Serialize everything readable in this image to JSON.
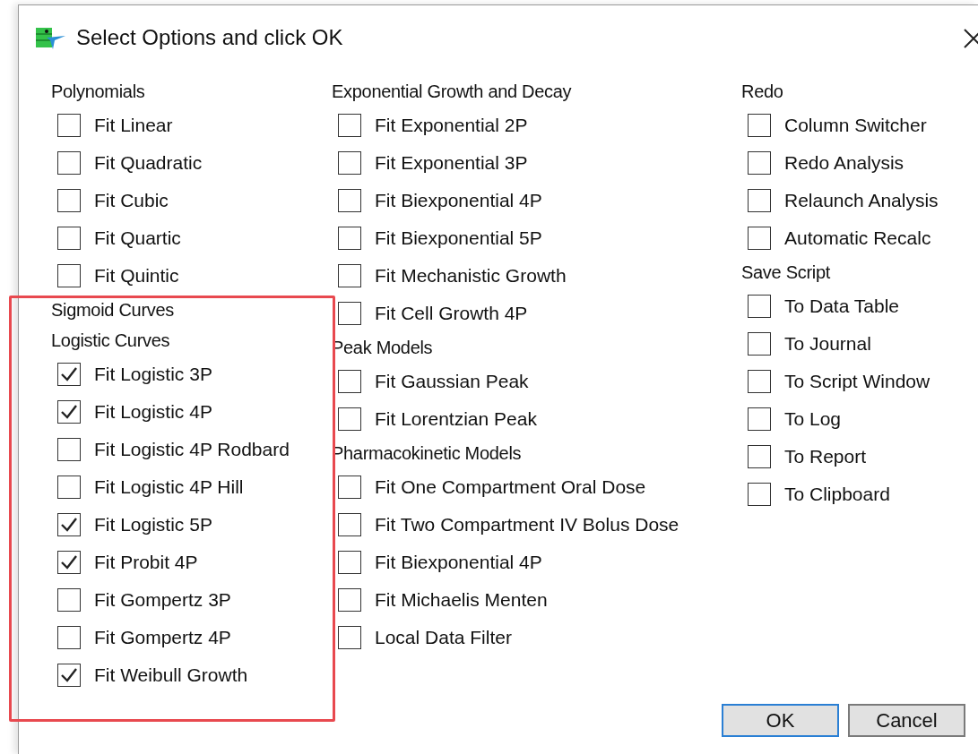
{
  "window": {
    "title": "Select Options and click OK"
  },
  "columns": [
    {
      "items": [
        {
          "kind": "heading",
          "label": "Polynomials"
        },
        {
          "kind": "checkbox",
          "label": "Fit Linear",
          "checked": false
        },
        {
          "kind": "checkbox",
          "label": "Fit Quadratic",
          "checked": false
        },
        {
          "kind": "checkbox",
          "label": "Fit Cubic",
          "checked": false
        },
        {
          "kind": "checkbox",
          "label": "Fit Quartic",
          "checked": false
        },
        {
          "kind": "checkbox",
          "label": "Fit Quintic",
          "checked": false
        },
        {
          "kind": "heading",
          "label": "Sigmoid Curves"
        },
        {
          "kind": "heading",
          "label": "Logistic Curves"
        },
        {
          "kind": "checkbox",
          "label": "Fit Logistic 3P",
          "checked": true
        },
        {
          "kind": "checkbox",
          "label": "Fit Logistic 4P",
          "checked": true
        },
        {
          "kind": "checkbox",
          "label": "Fit Logistic 4P Rodbard",
          "checked": false
        },
        {
          "kind": "checkbox",
          "label": "Fit Logistic 4P Hill",
          "checked": false
        },
        {
          "kind": "checkbox",
          "label": "Fit Logistic 5P",
          "checked": true
        },
        {
          "kind": "checkbox",
          "label": "Fit Probit 4P",
          "checked": true
        },
        {
          "kind": "checkbox",
          "label": "Fit Gompertz 3P",
          "checked": false
        },
        {
          "kind": "checkbox",
          "label": "Fit Gompertz 4P",
          "checked": false
        },
        {
          "kind": "checkbox",
          "label": "Fit Weibull Growth",
          "checked": true
        }
      ]
    },
    {
      "items": [
        {
          "kind": "heading",
          "label": "Exponential Growth and Decay"
        },
        {
          "kind": "checkbox",
          "label": "Fit Exponential 2P",
          "checked": false
        },
        {
          "kind": "checkbox",
          "label": "Fit Exponential 3P",
          "checked": false
        },
        {
          "kind": "checkbox",
          "label": "Fit Biexponential 4P",
          "checked": false
        },
        {
          "kind": "checkbox",
          "label": "Fit Biexponential 5P",
          "checked": false
        },
        {
          "kind": "checkbox",
          "label": "Fit Mechanistic Growth",
          "checked": false
        },
        {
          "kind": "checkbox",
          "label": "Fit Cell Growth 4P",
          "checked": false
        },
        {
          "kind": "heading",
          "label": "Peak Models"
        },
        {
          "kind": "checkbox",
          "label": "Fit Gaussian Peak",
          "checked": false
        },
        {
          "kind": "checkbox",
          "label": "Fit Lorentzian Peak",
          "checked": false
        },
        {
          "kind": "heading",
          "label": "Pharmacokinetic Models"
        },
        {
          "kind": "checkbox",
          "label": "Fit One Compartment Oral Dose",
          "checked": false
        },
        {
          "kind": "checkbox",
          "label": "Fit Two Compartment IV Bolus Dose",
          "checked": false
        },
        {
          "kind": "checkbox",
          "label": "Fit Biexponential 4P",
          "checked": false
        },
        {
          "kind": "checkbox",
          "label": "Fit Michaelis Menten",
          "checked": false
        },
        {
          "kind": "checkbox",
          "label": "Local Data Filter",
          "checked": false
        }
      ]
    },
    {
      "items": [
        {
          "kind": "heading",
          "label": "Redo"
        },
        {
          "kind": "checkbox",
          "label": "Column Switcher",
          "checked": false
        },
        {
          "kind": "checkbox",
          "label": "Redo Analysis",
          "checked": false
        },
        {
          "kind": "checkbox",
          "label": "Relaunch Analysis",
          "checked": false
        },
        {
          "kind": "checkbox",
          "label": "Automatic Recalc",
          "checked": false
        },
        {
          "kind": "heading",
          "label": "Save Script"
        },
        {
          "kind": "checkbox",
          "label": "To Data Table",
          "checked": false
        },
        {
          "kind": "checkbox",
          "label": "To Journal",
          "checked": false
        },
        {
          "kind": "checkbox",
          "label": "To Script Window",
          "checked": false
        },
        {
          "kind": "checkbox",
          "label": "To Log",
          "checked": false
        },
        {
          "kind": "checkbox",
          "label": "To Report",
          "checked": false
        },
        {
          "kind": "checkbox",
          "label": "To Clipboard",
          "checked": false
        }
      ]
    }
  ],
  "buttons": [
    {
      "label": "OK",
      "default": true
    },
    {
      "label": "Cancel",
      "default": false
    }
  ]
}
